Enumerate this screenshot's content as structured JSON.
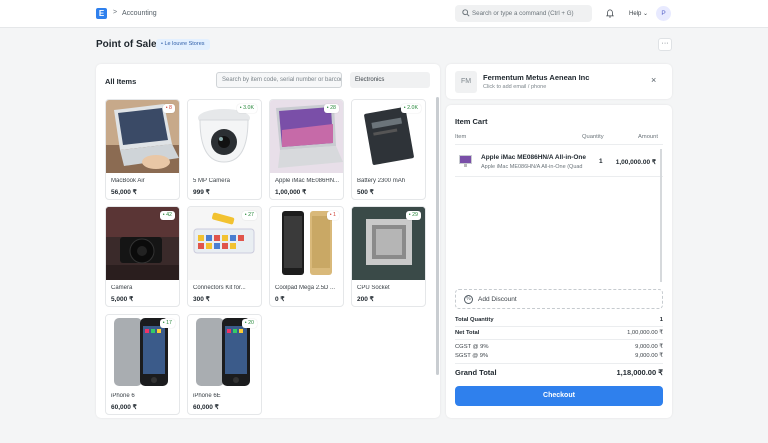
{
  "topbar": {
    "logo_letter": "E",
    "breadcrumb_sep": ">",
    "breadcrumb": "Accounting",
    "search_placeholder": "Search or type a command (Ctrl + G)",
    "help_label": "Help",
    "avatar_letter": "P"
  },
  "page": {
    "title": "Point of Sale",
    "store_badge": "• Le louvre Stores",
    "more_label": "···"
  },
  "items_panel": {
    "title": "All Items",
    "search_placeholder": "Search by item code, serial number or barcode",
    "item_group": "Electronics",
    "items": [
      {
        "name": "MacBook Air",
        "price": "56,000 ₹",
        "stock": "• 8",
        "stock_status": "low",
        "icon": "laptop-photo"
      },
      {
        "name": "5 MP Camera",
        "price": "999 ₹",
        "stock": "• 3.0K",
        "stock_status": "ok",
        "icon": "dome-camera-photo"
      },
      {
        "name": "Apple iMac ME086HN...",
        "price": "1,00,000 ₹",
        "stock": "• 28",
        "stock_status": "ok",
        "icon": "imac-photo"
      },
      {
        "name": "Battery 2300 mAh",
        "price": "500 ₹",
        "stock": "• 2.0K",
        "stock_status": "ok",
        "icon": "battery-photo"
      },
      {
        "name": "Camera",
        "price": "5,000 ₹",
        "stock": "• 42",
        "stock_status": "ok",
        "icon": "dslr-camera-photo"
      },
      {
        "name": "Connectors Kit for...",
        "price": "300 ₹",
        "stock": "• 27",
        "stock_status": "ok",
        "icon": "connectors-kit-photo"
      },
      {
        "name": "Coolpad Mega 2.5D ...",
        "price": "0 ₹",
        "stock": "• 1",
        "stock_status": "low",
        "icon": "phone-photo"
      },
      {
        "name": "CPU Socket",
        "price": "200 ₹",
        "stock": "• 29",
        "stock_status": "ok",
        "icon": "cpu-socket-photo"
      },
      {
        "name": "iPhone 6",
        "price": "60,000 ₹",
        "stock": "• 17",
        "stock_status": "ok",
        "icon": "iphone-photo"
      },
      {
        "name": "iPhone 6E",
        "price": "60,000 ₹",
        "stock": "• 20",
        "stock_status": "ok",
        "icon": "iphone-photo"
      }
    ]
  },
  "customer": {
    "initials": "FM",
    "name": "Fermentum Metus Aenean Inc",
    "hint": "Click to add email / phone",
    "close": "×"
  },
  "cart": {
    "title": "Item Cart",
    "headers": {
      "item": "Item",
      "quantity": "Quantity",
      "amount": "Amount"
    },
    "rows": [
      {
        "name": "Apple iMac ME086HN/A All-in-One",
        "sub": "Apple iMac ME086HN/A All-in-One (Quad",
        "qty": "1",
        "amount": "1,00,000.00 ₹"
      }
    ],
    "discount_label": "Add Discount",
    "discount_icon": "%",
    "summary": {
      "total_qty_label": "Total Quantity",
      "total_qty": "1",
      "net_total_label": "Net Total",
      "net_total": "1,00,000.00 ₹",
      "cgst_label": "CGST @ 9%",
      "cgst": "9,000.00 ₹",
      "sgst_label": "SGST @ 9%",
      "sgst": "9,000.00 ₹",
      "grand_total_label": "Grand Total",
      "grand_total": "1,18,000.00 ₹"
    },
    "checkout_label": "Checkout"
  },
  "colors": {
    "primary": "#2f80ed",
    "stock_ok": "#2b8a3e",
    "stock_low": "#d0463b"
  }
}
